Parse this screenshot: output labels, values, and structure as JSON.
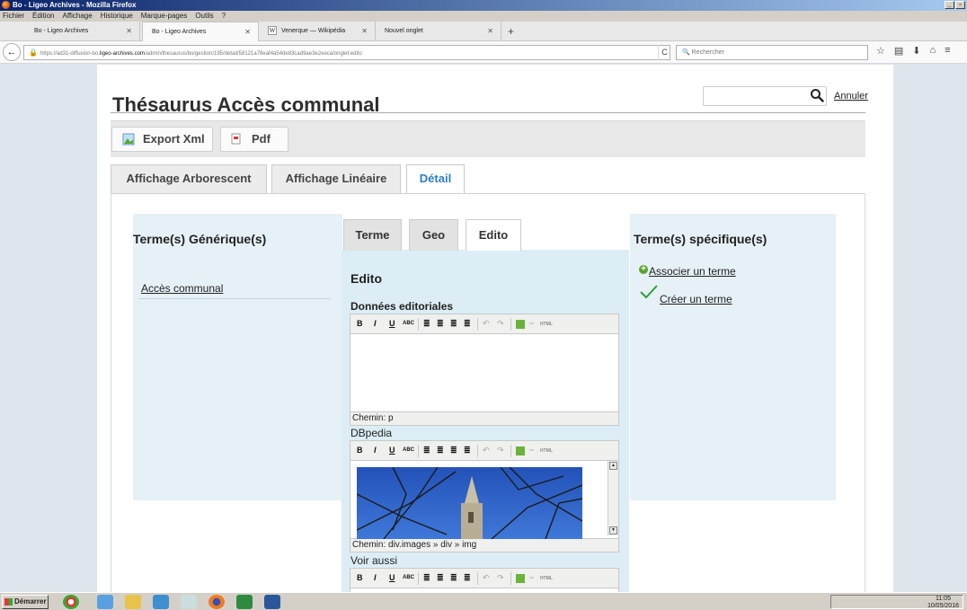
{
  "window": {
    "title": "Bo - Ligeo Archives - Mozilla Firefox"
  },
  "menu": [
    "Fichier",
    "Édition",
    "Affichage",
    "Historique",
    "Marque-pages",
    "Outils",
    "?"
  ],
  "browser_tabs": [
    {
      "label": "Bo - Ligeo Archives",
      "active": false
    },
    {
      "label": "Bo - Ligeo Archives",
      "active": true
    },
    {
      "label": "Venerque — Wikipédia",
      "active": false
    },
    {
      "label": "Nouvel onglet",
      "active": false
    }
  ],
  "nav": {
    "url_prefix": "https://ad31-diffusion-bo.",
    "url_host": "ligeo-archives.com",
    "url_path": "/admin/thesaurus/bo/gestion/195/detail/58121a78eaf4a54de83cad9ae3e2eeca/onglet:edito",
    "search_placeholder": "Rechercher"
  },
  "page": {
    "title": "Thésaurus Accès communal",
    "search_value": "",
    "cancel_label": "Annuler",
    "toolbar": {
      "export_xml": "Export Xml",
      "pdf": "Pdf"
    },
    "view_tabs": [
      "Affichage Arborescent",
      "Affichage Linéaire",
      "Détail"
    ],
    "active_view_tab": "Détail",
    "generic": {
      "heading": "Terme(s) Générique(s)",
      "items": [
        "Accès communal"
      ]
    },
    "detail_tabs": [
      "Terme",
      "Geo",
      "Edito"
    ],
    "active_detail_tab": "Edito",
    "edito": {
      "heading": "Edito",
      "donnees_label": "Données editoriales",
      "donnees_path": "Chemin: p",
      "dbpedia_label": "DBpedia",
      "dbpedia_path": "Chemin: div.images » div » img",
      "voir_aussi_label": "Voir aussi"
    },
    "specific": {
      "heading": "Terme(s) spécifique(s)",
      "associate_label": "Associer un terme",
      "create_label": "Créer un terme"
    }
  },
  "taskbar": {
    "start_label": "Démarrer",
    "time": "11:05",
    "date": "10/05/2016"
  },
  "colors": {
    "accent_tab": "#2e7fc1",
    "panel_bg": "#e6f1f7",
    "mid_bg": "#dcedf5",
    "page_bg": "#dfe5ec"
  }
}
